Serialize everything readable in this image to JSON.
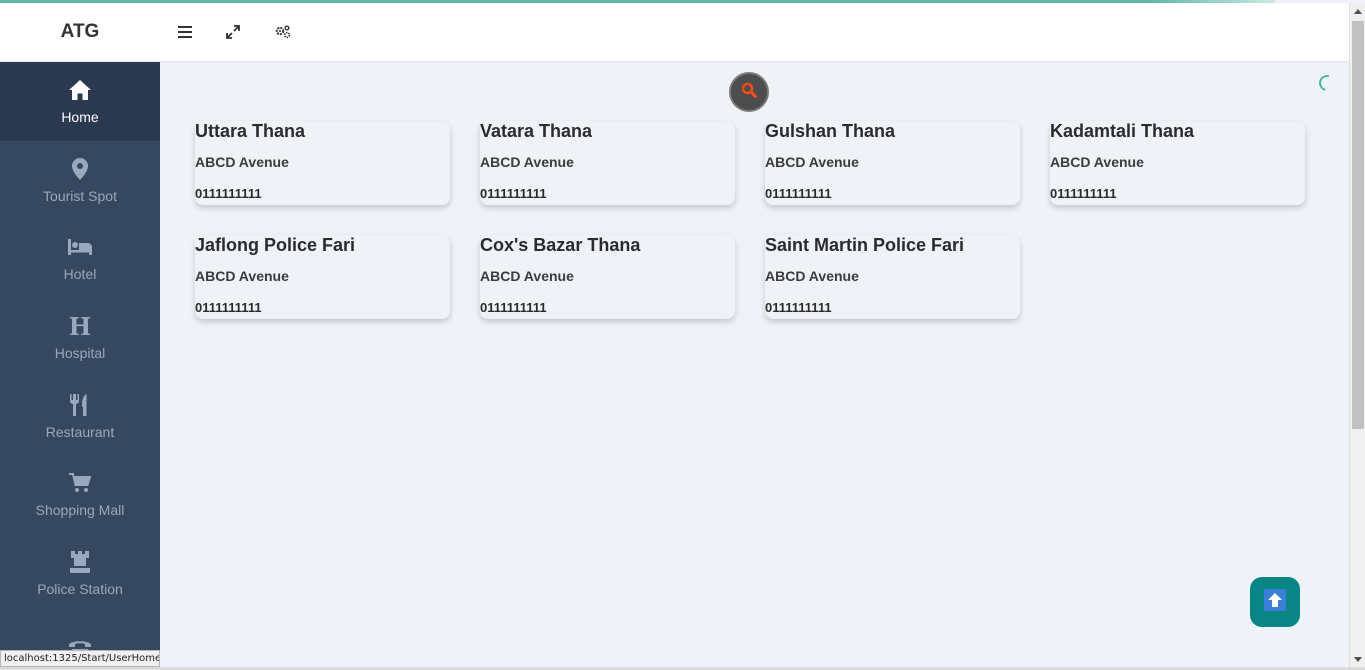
{
  "brand": "ATG",
  "header": {
    "menu_icon": "hamburger-icon",
    "expand_icon": "expand-icon",
    "settings_icon": "gears-icon"
  },
  "sidebar": {
    "items": [
      {
        "label": "Home",
        "icon": "home-icon",
        "active": true
      },
      {
        "label": "Tourist Spot",
        "icon": "map-marker-icon"
      },
      {
        "label": "Hotel",
        "icon": "bed-icon"
      },
      {
        "label": "Hospital",
        "icon": "hospital-h-icon"
      },
      {
        "label": "Restaurant",
        "icon": "cutlery-icon"
      },
      {
        "label": "Shopping Mall",
        "icon": "cart-icon"
      },
      {
        "label": "Police Station",
        "icon": "tower-icon"
      },
      {
        "label": "",
        "icon": "phone-icon"
      }
    ]
  },
  "cards": [
    {
      "name": "Uttara Thana",
      "address": "ABCD Avenue",
      "phone": "0111111111"
    },
    {
      "name": "Vatara Thana",
      "address": "ABCD Avenue",
      "phone": "0111111111"
    },
    {
      "name": "Gulshan Thana",
      "address": "ABCD Avenue",
      "phone": "0111111111"
    },
    {
      "name": "Kadamtali Thana",
      "address": "ABCD Avenue",
      "phone": "0111111111"
    },
    {
      "name": "Jaflong Police Fari",
      "address": "ABCD Avenue",
      "phone": "0111111111"
    },
    {
      "name": "Cox's Bazar Thana",
      "address": "ABCD Avenue",
      "phone": "0111111111"
    },
    {
      "name": "Saint Martin Police Fari",
      "address": "ABCD Avenue",
      "phone": "0111111111"
    }
  ],
  "status_url": "localhost:1325/Start/UserHome",
  "colors": {
    "sidebar": "#364760",
    "sidebar_active": "#2a3850",
    "accent": "#5fb8a6",
    "scroll_top_button": "#0a8585"
  }
}
